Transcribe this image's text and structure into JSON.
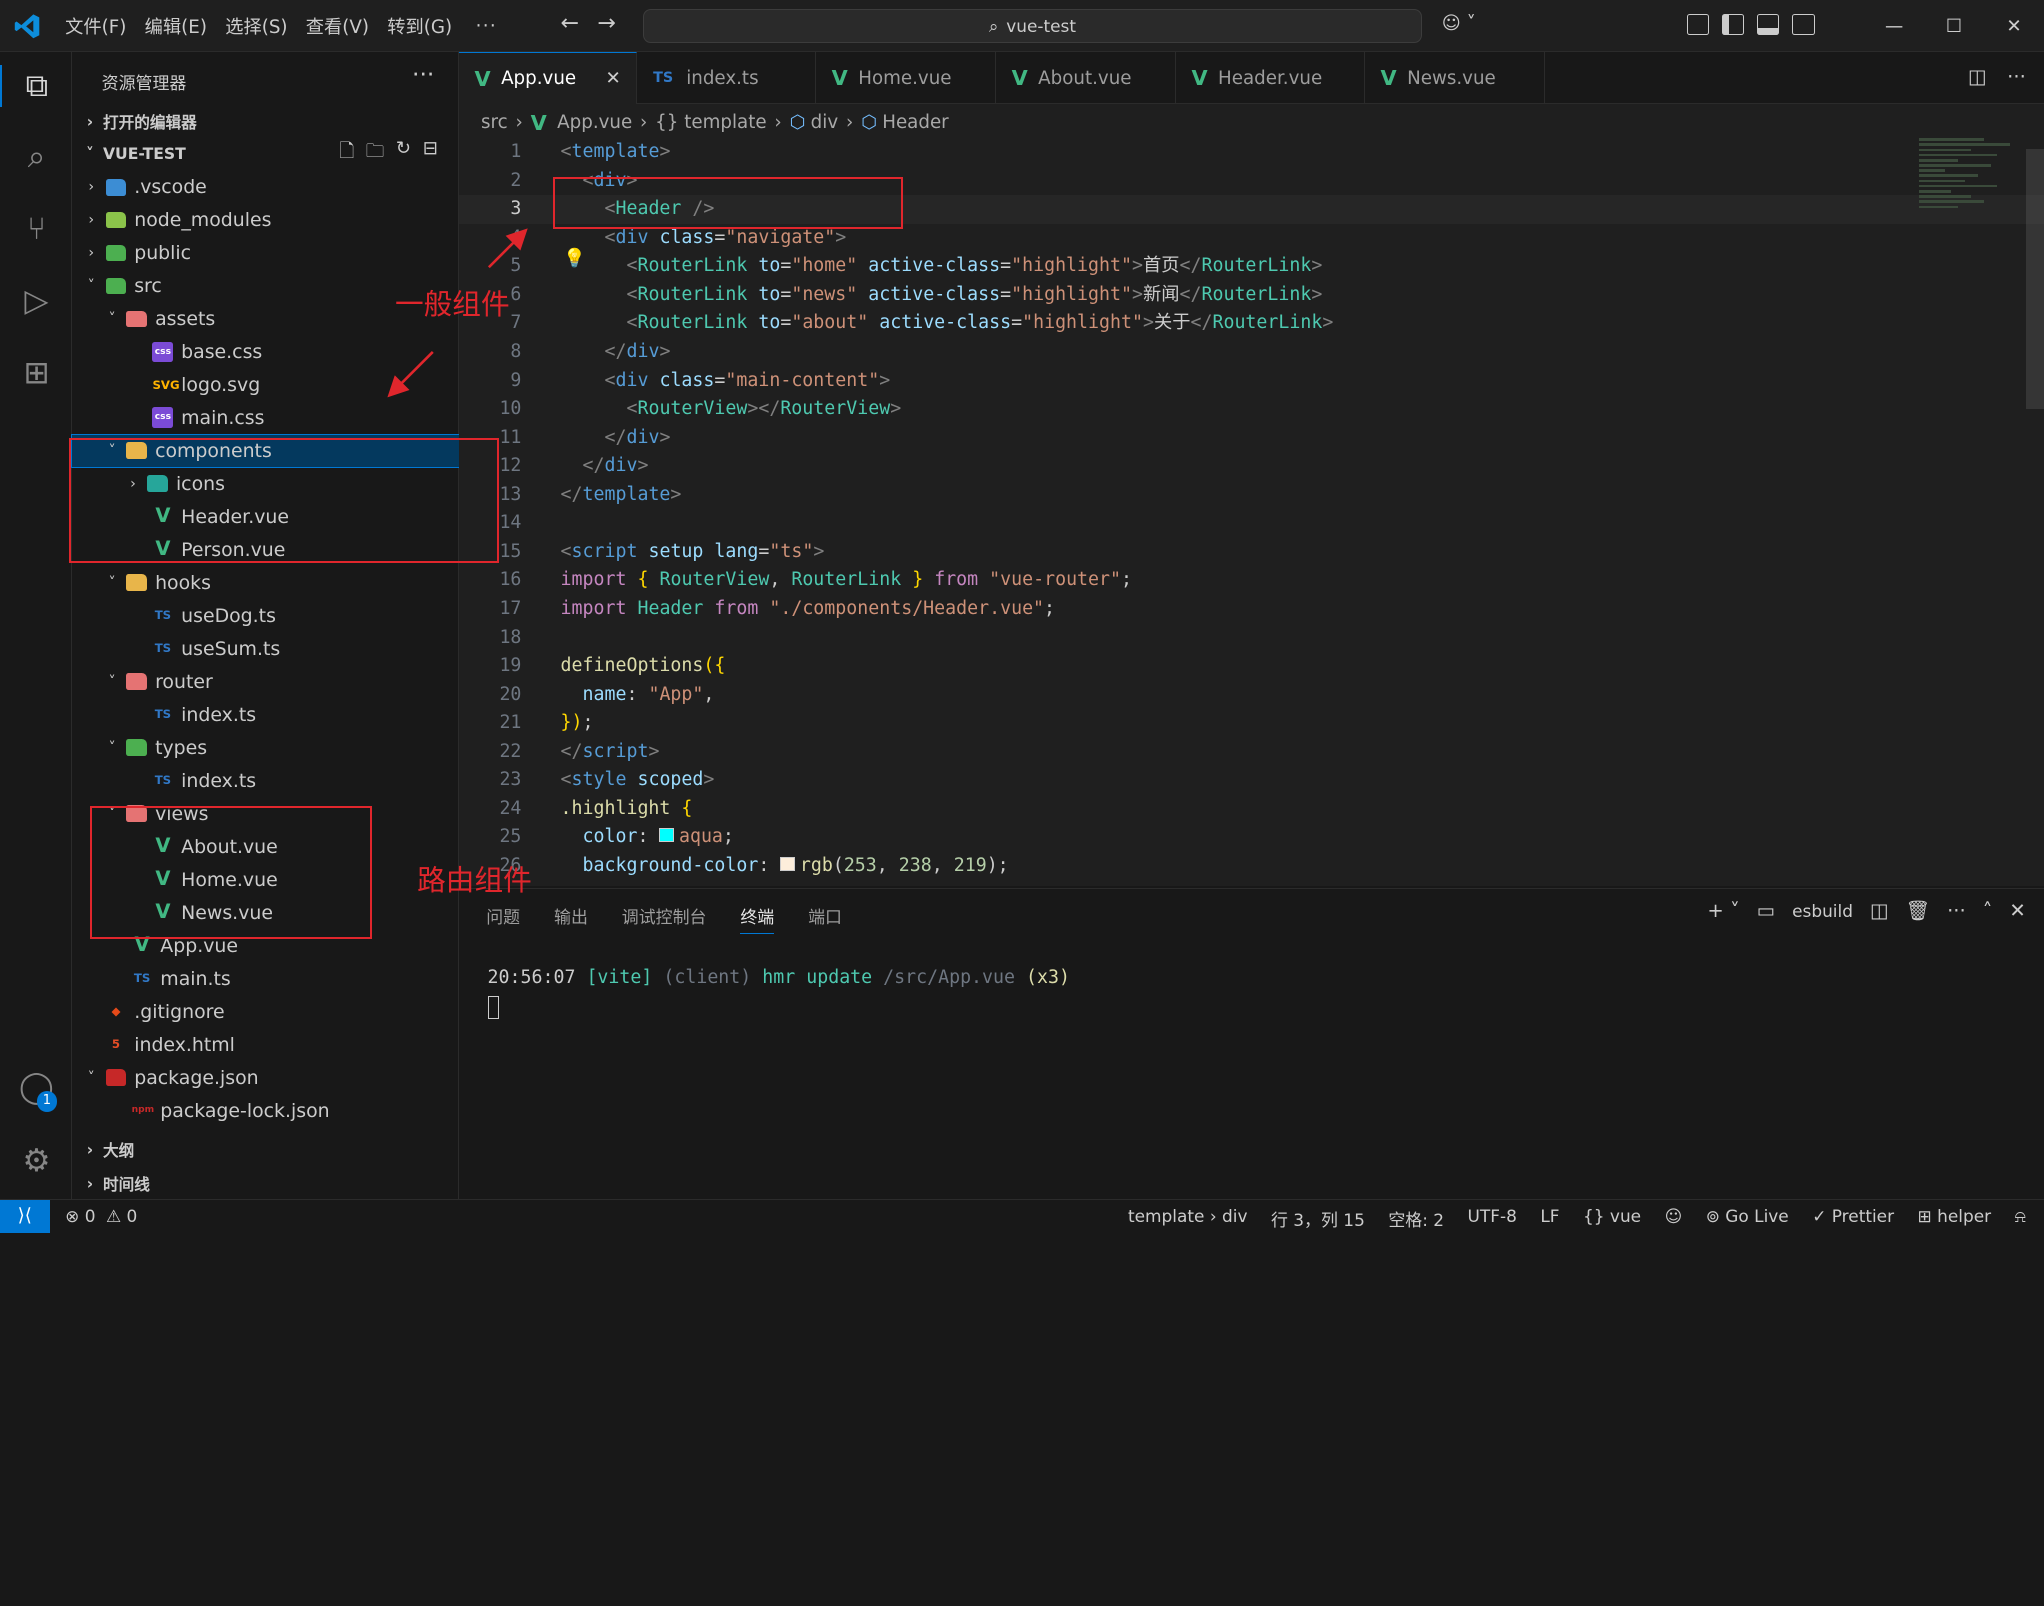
{
  "titlebar": {
    "menu": [
      "文件(F)",
      "编辑(E)",
      "选择(S)",
      "查看(V)",
      "转到(G)",
      "···"
    ],
    "search": "vue-test",
    "window_buttons": [
      "—",
      "☐",
      "✕"
    ]
  },
  "sidebar": {
    "title": "资源管理器",
    "open_editors": "打开的编辑器",
    "project": "VUE-TEST",
    "outline": "大纲",
    "timeline": "时间线",
    "tree": [
      {
        "name": ".vscode",
        "level": 1,
        "kind": "folder",
        "open": false,
        "icon": "vscode-folder-icon",
        "color": "#3c8dd4"
      },
      {
        "name": "node_modules",
        "level": 1,
        "kind": "folder",
        "open": false,
        "icon": "node-folder-icon",
        "color": "#8bc34a"
      },
      {
        "name": "public",
        "level": 1,
        "kind": "folder",
        "open": false,
        "icon": "public-folder-icon",
        "color": "#4caf50"
      },
      {
        "name": "src",
        "level": 1,
        "kind": "folder",
        "open": true,
        "icon": "src-folder-icon",
        "color": "#4caf50"
      },
      {
        "name": "assets",
        "level": 2,
        "kind": "folder",
        "open": true,
        "icon": "assets-folder-icon",
        "color": "#e57373"
      },
      {
        "name": "base.css",
        "level": 3,
        "kind": "file",
        "icon": "css-file-icon",
        "color": "#7b4bd6",
        "glyph": "css"
      },
      {
        "name": "logo.svg",
        "level": 3,
        "kind": "file",
        "icon": "svg-file-icon",
        "color": "#ffb300",
        "glyph": "SVG"
      },
      {
        "name": "main.css",
        "level": 3,
        "kind": "file",
        "icon": "css-file-icon",
        "color": "#7b4bd6",
        "glyph": "css"
      },
      {
        "name": "components",
        "level": 2,
        "kind": "folder",
        "open": true,
        "icon": "components-folder-icon",
        "color": "#e8b54a",
        "selected": true
      },
      {
        "name": "icons",
        "level": 3,
        "kind": "folder",
        "open": false,
        "icon": "icons-folder-icon",
        "color": "#26a69a"
      },
      {
        "name": "Header.vue",
        "level": 3,
        "kind": "file",
        "icon": "vue-file-icon",
        "color": "#41b883",
        "glyph": "V"
      },
      {
        "name": "Person.vue",
        "level": 3,
        "kind": "file",
        "icon": "vue-file-icon",
        "color": "#41b883",
        "glyph": "V"
      },
      {
        "name": "hooks",
        "level": 2,
        "kind": "folder",
        "open": true,
        "icon": "hooks-folder-icon",
        "color": "#e8b54a"
      },
      {
        "name": "useDog.ts",
        "level": 3,
        "kind": "file",
        "icon": "ts-file-icon",
        "color": "#3178c6",
        "glyph": "TS"
      },
      {
        "name": "useSum.ts",
        "level": 3,
        "kind": "file",
        "icon": "ts-file-icon",
        "color": "#3178c6",
        "glyph": "TS"
      },
      {
        "name": "router",
        "level": 2,
        "kind": "folder",
        "open": true,
        "icon": "router-folder-icon",
        "color": "#e57373"
      },
      {
        "name": "index.ts",
        "level": 3,
        "kind": "file",
        "icon": "ts-file-icon",
        "color": "#3178c6",
        "glyph": "TS"
      },
      {
        "name": "types",
        "level": 2,
        "kind": "folder",
        "open": true,
        "icon": "types-folder-icon",
        "color": "#4caf50"
      },
      {
        "name": "index.ts",
        "level": 3,
        "kind": "file",
        "icon": "ts-file-icon",
        "color": "#3178c6",
        "glyph": "TS"
      },
      {
        "name": "views",
        "level": 2,
        "kind": "folder",
        "open": true,
        "icon": "views-folder-icon",
        "color": "#e57373"
      },
      {
        "name": "About.vue",
        "level": 3,
        "kind": "file",
        "icon": "vue-file-icon",
        "color": "#41b883",
        "glyph": "V"
      },
      {
        "name": "Home.vue",
        "level": 3,
        "kind": "file",
        "icon": "vue-file-icon",
        "color": "#41b883",
        "glyph": "V"
      },
      {
        "name": "News.vue",
        "level": 3,
        "kind": "file",
        "icon": "vue-file-icon",
        "color": "#41b883",
        "glyph": "V"
      },
      {
        "name": "App.vue",
        "level": 2,
        "kind": "file",
        "icon": "vue-file-icon",
        "color": "#41b883",
        "glyph": "V"
      },
      {
        "name": "main.ts",
        "level": 2,
        "kind": "file",
        "icon": "ts-file-icon",
        "color": "#3178c6",
        "glyph": "TS"
      },
      {
        "name": ".gitignore",
        "level": 1,
        "kind": "file",
        "icon": "git-file-icon",
        "color": "#e64a19",
        "glyph": "◆"
      },
      {
        "name": "index.html",
        "level": 1,
        "kind": "file",
        "icon": "html-file-icon",
        "color": "#e44d26",
        "glyph": "5"
      },
      {
        "name": "package.json",
        "level": 1,
        "kind": "folder",
        "open": true,
        "icon": "npm-file-icon",
        "color": "#c62828",
        "glyph": "npm"
      },
      {
        "name": "package-lock.json",
        "level": 2,
        "kind": "file",
        "icon": "npm-file-icon",
        "color": "#c62828",
        "glyph": "npm"
      }
    ]
  },
  "tabs": [
    {
      "label": "App.vue",
      "type": "vue",
      "active": true
    },
    {
      "label": "index.ts",
      "type": "ts"
    },
    {
      "label": "Home.vue",
      "type": "vue"
    },
    {
      "label": "About.vue",
      "type": "vue"
    },
    {
      "label": "Header.vue",
      "type": "vue"
    },
    {
      "label": "News.vue",
      "type": "vue"
    }
  ],
  "breadcrumb": [
    "src",
    "App.vue",
    "{} template",
    "div",
    "Header"
  ],
  "code": {
    "current_line": 3,
    "lines": [
      [
        [
          "k-punc",
          "<"
        ],
        [
          "k-tag",
          "template"
        ],
        [
          "k-punc",
          ">"
        ]
      ],
      [
        [
          "",
          "  "
        ],
        [
          "k-punc",
          "<"
        ],
        [
          "k-tag",
          "div"
        ],
        [
          "k-punc",
          ">"
        ]
      ],
      [
        [
          "",
          "    "
        ],
        [
          "k-punc",
          "<"
        ],
        [
          "k-comp",
          "Header"
        ],
        [
          "",
          " "
        ],
        [
          "k-punc",
          "/>"
        ]
      ],
      [
        [
          "",
          "    "
        ],
        [
          "k-punc",
          "<"
        ],
        [
          "k-tag",
          "div"
        ],
        [
          "",
          " "
        ],
        [
          "k-attr",
          "class"
        ],
        [
          "",
          "="
        ],
        [
          "k-str",
          "\"navigate\""
        ],
        [
          "k-punc",
          ">"
        ]
      ],
      [
        [
          "",
          "      "
        ],
        [
          "k-punc",
          "<"
        ],
        [
          "k-comp",
          "RouterLink"
        ],
        [
          "",
          " "
        ],
        [
          "k-attr",
          "to"
        ],
        [
          "",
          "="
        ],
        [
          "k-str",
          "\"home\""
        ],
        [
          "",
          " "
        ],
        [
          "k-attr",
          "active-class"
        ],
        [
          "",
          "="
        ],
        [
          "k-str",
          "\"highlight\""
        ],
        [
          "k-punc",
          ">"
        ],
        [
          "",
          "首页"
        ],
        [
          "k-punc",
          "</"
        ],
        [
          "k-comp",
          "RouterLink"
        ],
        [
          "k-punc",
          ">"
        ]
      ],
      [
        [
          "",
          "      "
        ],
        [
          "k-punc",
          "<"
        ],
        [
          "k-comp",
          "RouterLink"
        ],
        [
          "",
          " "
        ],
        [
          "k-attr",
          "to"
        ],
        [
          "",
          "="
        ],
        [
          "k-str",
          "\"news\""
        ],
        [
          "",
          " "
        ],
        [
          "k-attr",
          "active-class"
        ],
        [
          "",
          "="
        ],
        [
          "k-str",
          "\"highlight\""
        ],
        [
          "k-punc",
          ">"
        ],
        [
          "",
          "新闻"
        ],
        [
          "k-punc",
          "</"
        ],
        [
          "k-comp",
          "RouterLink"
        ],
        [
          "k-punc",
          ">"
        ]
      ],
      [
        [
          "",
          "      "
        ],
        [
          "k-punc",
          "<"
        ],
        [
          "k-comp",
          "RouterLink"
        ],
        [
          "",
          " "
        ],
        [
          "k-attr",
          "to"
        ],
        [
          "",
          "="
        ],
        [
          "k-str",
          "\"about\""
        ],
        [
          "",
          " "
        ],
        [
          "k-attr",
          "active-class"
        ],
        [
          "",
          "="
        ],
        [
          "k-str",
          "\"highlight\""
        ],
        [
          "k-punc",
          ">"
        ],
        [
          "",
          "关于"
        ],
        [
          "k-punc",
          "</"
        ],
        [
          "k-comp",
          "RouterLink"
        ],
        [
          "k-punc",
          ">"
        ]
      ],
      [
        [
          "",
          "    "
        ],
        [
          "k-punc",
          "</"
        ],
        [
          "k-tag",
          "div"
        ],
        [
          "k-punc",
          ">"
        ]
      ],
      [
        [
          "",
          "    "
        ],
        [
          "k-punc",
          "<"
        ],
        [
          "k-tag",
          "div"
        ],
        [
          "",
          " "
        ],
        [
          "k-attr",
          "class"
        ],
        [
          "",
          "="
        ],
        [
          "k-str",
          "\"main-content\""
        ],
        [
          "k-punc",
          ">"
        ]
      ],
      [
        [
          "",
          "      "
        ],
        [
          "k-punc",
          "<"
        ],
        [
          "k-comp",
          "RouterView"
        ],
        [
          "k-punc",
          "></"
        ],
        [
          "k-comp",
          "RouterView"
        ],
        [
          "k-punc",
          ">"
        ]
      ],
      [
        [
          "",
          "    "
        ],
        [
          "k-punc",
          "</"
        ],
        [
          "k-tag",
          "div"
        ],
        [
          "k-punc",
          ">"
        ]
      ],
      [
        [
          "",
          "  "
        ],
        [
          "k-punc",
          "</"
        ],
        [
          "k-tag",
          "div"
        ],
        [
          "k-punc",
          ">"
        ]
      ],
      [
        [
          "k-punc",
          "</"
        ],
        [
          "k-tag",
          "template"
        ],
        [
          "k-punc",
          ">"
        ]
      ],
      [],
      [
        [
          "k-punc",
          "<"
        ],
        [
          "k-tag",
          "script"
        ],
        [
          "",
          " "
        ],
        [
          "k-attr",
          "setup"
        ],
        [
          "",
          " "
        ],
        [
          "k-attr",
          "lang"
        ],
        [
          "",
          "="
        ],
        [
          "k-str",
          "\"ts\""
        ],
        [
          "k-punc",
          ">"
        ]
      ],
      [
        [
          "k-kw",
          "import"
        ],
        [
          "",
          " "
        ],
        [
          "k-yel",
          "{"
        ],
        [
          "",
          " "
        ],
        [
          "k-comp",
          "RouterView"
        ],
        [
          "",
          ", "
        ],
        [
          "k-comp",
          "RouterLink"
        ],
        [
          "",
          " "
        ],
        [
          "k-yel",
          "}"
        ],
        [
          "",
          " "
        ],
        [
          "k-kw",
          "from"
        ],
        [
          "",
          " "
        ],
        [
          "k-str",
          "\"vue-router\""
        ],
        [
          "",
          ";"
        ]
      ],
      [
        [
          "k-kw",
          "import"
        ],
        [
          "",
          " "
        ],
        [
          "k-comp",
          "Header"
        ],
        [
          "",
          " "
        ],
        [
          "k-kw",
          "from"
        ],
        [
          "",
          " "
        ],
        [
          "k-str",
          "\"./components/Header.vue\""
        ],
        [
          "",
          ";"
        ]
      ],
      [],
      [
        [
          "k-fn",
          "defineOptions"
        ],
        [
          "k-yel",
          "({"
        ]
      ],
      [
        [
          "",
          "  "
        ],
        [
          "k-prop",
          "name"
        ],
        [
          "",
          ": "
        ],
        [
          "k-str",
          "\"App\""
        ],
        [
          "",
          ","
        ]
      ],
      [
        [
          "k-yel",
          "})"
        ],
        [
          "",
          ";"
        ]
      ],
      [
        [
          "k-punc",
          "</"
        ],
        [
          "k-tag",
          "script"
        ],
        [
          "k-punc",
          ">"
        ]
      ],
      [
        [
          "k-punc",
          "<"
        ],
        [
          "k-tag",
          "style"
        ],
        [
          "",
          " "
        ],
        [
          "k-attr",
          "scoped"
        ],
        [
          "k-punc",
          ">"
        ]
      ],
      [
        [
          "k-fn",
          ".highlight"
        ],
        [
          "",
          " "
        ],
        [
          "k-yel",
          "{"
        ]
      ],
      [
        [
          "",
          "  "
        ],
        [
          "k-prop",
          "color"
        ],
        [
          "",
          ": "
        ],
        [
          "swatch-aqua",
          ""
        ],
        [
          "k-str",
          "aqua"
        ],
        [
          "",
          ";"
        ]
      ],
      [
        [
          "",
          "  "
        ],
        [
          "k-prop",
          "background-color"
        ],
        [
          "",
          ": "
        ],
        [
          "swatch-rgb",
          ""
        ],
        [
          "k-fn",
          "rgb"
        ],
        [
          "",
          "("
        ],
        [
          "k-num",
          "253"
        ],
        [
          "",
          ", "
        ],
        [
          "k-num",
          "238"
        ],
        [
          "",
          ", "
        ],
        [
          "k-num",
          "219"
        ],
        [
          "",
          ");"
        ]
      ]
    ]
  },
  "panel": {
    "tabs": [
      "问题",
      "输出",
      "调试控制台",
      "终端",
      "端口"
    ],
    "active_tab": "终端",
    "shell": "esbuild",
    "terminal_time": "20:56:07",
    "terminal_vite": "[vite]",
    "terminal_client": "(client)",
    "terminal_msg": "hmr update",
    "terminal_path": "/src/App.vue",
    "terminal_count": "(x3)"
  },
  "status": {
    "errors": "⊗ 0",
    "warnings": "⚠ 0",
    "breadcrumb": "template › div",
    "position": "行 3，列 15",
    "spaces": "空格: 2",
    "encoding": "UTF-8",
    "eol": "LF",
    "language": "{} vue",
    "golive": "Go Live",
    "prettier": "✓ Prettier",
    "helper": "helper",
    "bell": "🔔"
  },
  "annotations": {
    "general_components": "一般组件",
    "route_components": "路由组件",
    "color": "#e0262c"
  },
  "colors": {
    "accent": "#0078d4",
    "vue": "#41b883",
    "ts": "#3178c6"
  }
}
